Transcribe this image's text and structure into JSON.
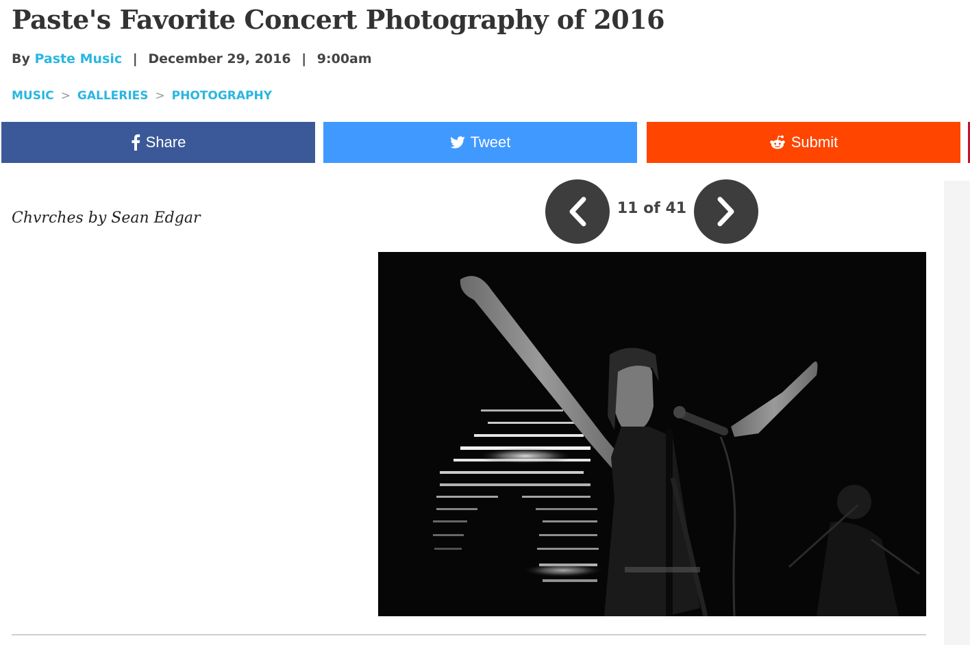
{
  "article": {
    "title": "Paste's Favorite Concert Photography of 2016",
    "byline": {
      "by": "By",
      "author": "Paste Music",
      "date": "December 29, 2016",
      "time": "9:00am",
      "separator": "|"
    },
    "breadcrumb": [
      "MUSIC",
      "GALLERIES",
      "PHOTOGRAPHY"
    ],
    "breadcrumb_separator": ">"
  },
  "share": {
    "facebook_label": "Share",
    "twitter_label": "Tweet",
    "reddit_label": "Submit",
    "colors": {
      "facebook": "#3b5998",
      "twitter": "#4099ff",
      "reddit": "#ff4500"
    }
  },
  "gallery": {
    "caption": "Chvrches by Sean Edgar",
    "counter": "11 of 41",
    "current": 11,
    "total": 41
  },
  "theme": {
    "link": "#29b6e0",
    "nav_button": "#3d3d3d"
  }
}
